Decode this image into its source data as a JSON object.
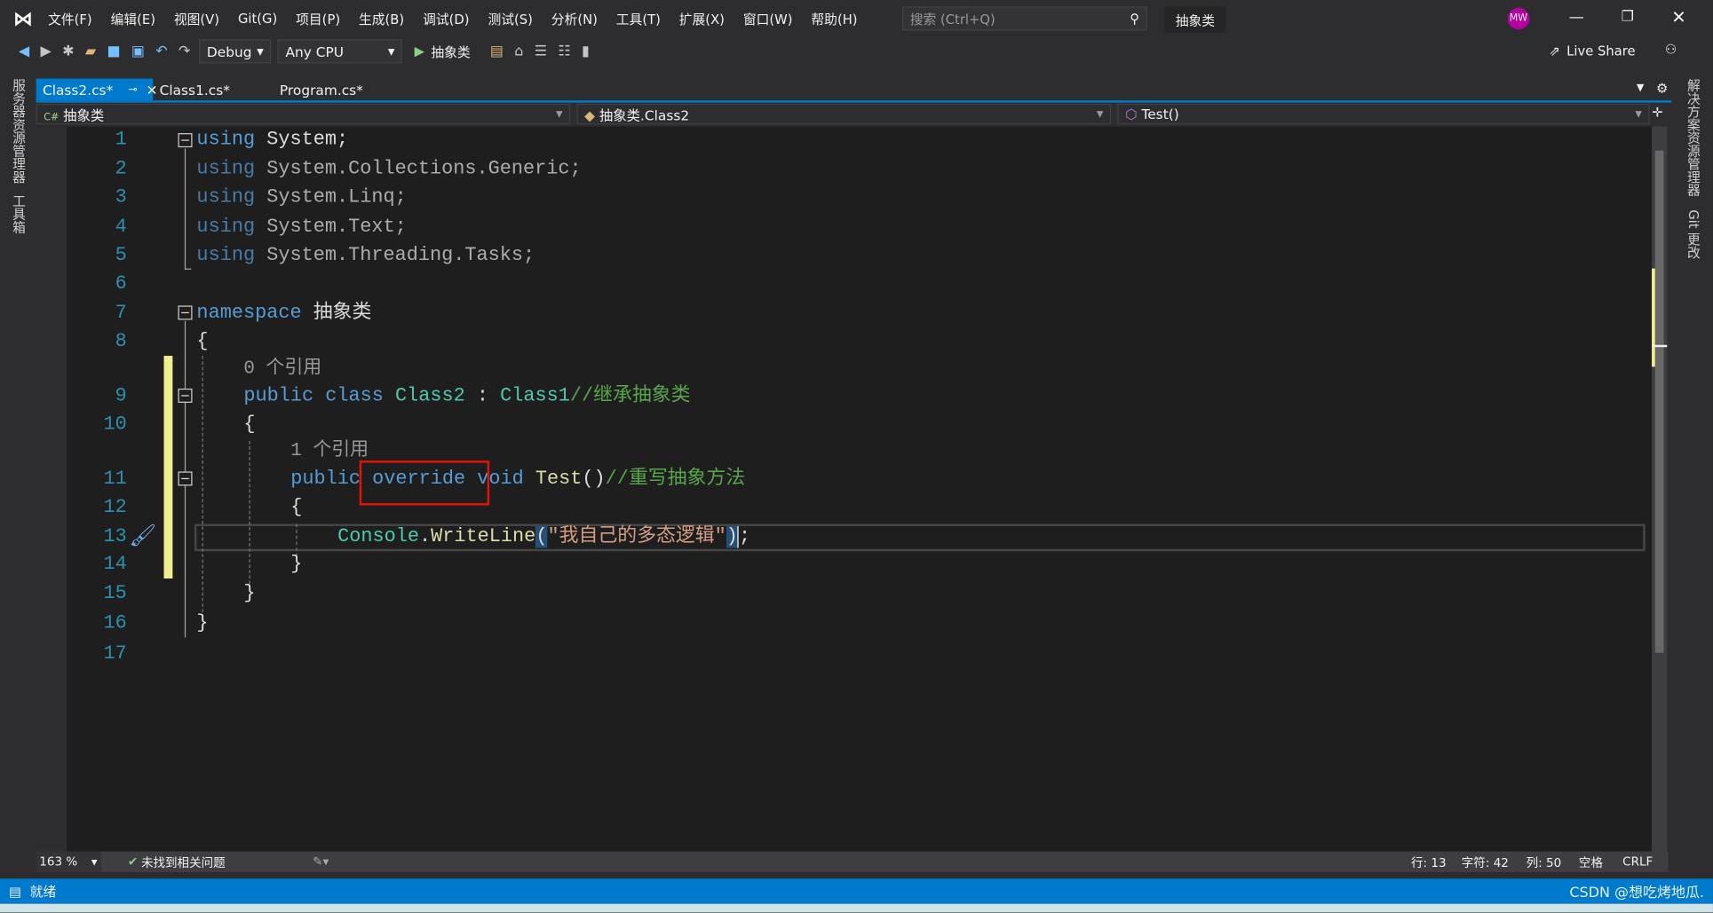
{
  "menu": {
    "items": [
      "文件(F)",
      "编辑(E)",
      "视图(V)",
      "Git(G)",
      "项目(P)",
      "生成(B)",
      "调试(D)",
      "测试(S)",
      "分析(N)",
      "工具(T)",
      "扩展(X)",
      "窗口(W)",
      "帮助(H)"
    ],
    "search_placeholder": "搜索 (Ctrl+Q)",
    "solution_name": "抽象类",
    "avatar": "MW"
  },
  "toolbar": {
    "config": "Debug",
    "platform": "Any CPU",
    "run_label": "抽象类",
    "live_share": "Live Share"
  },
  "tabs": [
    {
      "label": "Class2.cs*",
      "active": true
    },
    {
      "label": "Class1.cs*"
    },
    {
      "label": "Program.cs*"
    }
  ],
  "navbar": {
    "project": "抽象类",
    "type": "抽象类.Class2",
    "member": "Test()"
  },
  "side_left": [
    "服务器资源管理器",
    "工具箱"
  ],
  "side_right": [
    "解决方案资源管理器",
    "Git 更改"
  ],
  "editor": {
    "lines": [
      "1",
      "2",
      "3",
      "4",
      "5",
      "6",
      "7",
      "8",
      "9",
      "10",
      "11",
      "12",
      "13",
      "14",
      "15",
      "16",
      "17"
    ],
    "code": {
      "l1a": "using",
      "l1b": " System;",
      "l2a": "using",
      "l2b": " System.Collections.Generic;",
      "l3a": "using",
      "l3b": " System.Linq;",
      "l4a": "using",
      "l4b": " System.Text;",
      "l5a": "using",
      "l5b": " System.Threading.Tasks;",
      "l7a": "namespace",
      "l7b": " 抽象类",
      "l8": "{",
      "lens9": "0 个引用",
      "l9a": "public class",
      "l9b": "Class2",
      "l9c": " : ",
      "l9d": "Class1",
      "l9e": "//继承抽象类",
      "l10": "{",
      "lens11": "1 个引用",
      "l11a": "public override void",
      "l11b": "Test",
      "l11c": "()",
      "l11d": "//重写抽象方法",
      "l12": "{",
      "l13a": "Console",
      "l13b": ".",
      "l13c": "WriteLine",
      "l13d": "(",
      "l13e": "\"我自己的多态逻辑\"",
      "l13f": ")",
      "l13g": ";",
      "l14": "}",
      "l15": "}",
      "l16": "}"
    }
  },
  "highlight_color": "#e51400",
  "statusbar": {
    "zoom": "163 %",
    "issues": "未找到相关问题",
    "line": "行: 13",
    "char": "字符: 42",
    "col": "列: 50",
    "spaces": "空格",
    "eol": "CRLF"
  },
  "bottom": {
    "ready": "就绪",
    "watermark": "CSDN @想吃烤地瓜."
  }
}
